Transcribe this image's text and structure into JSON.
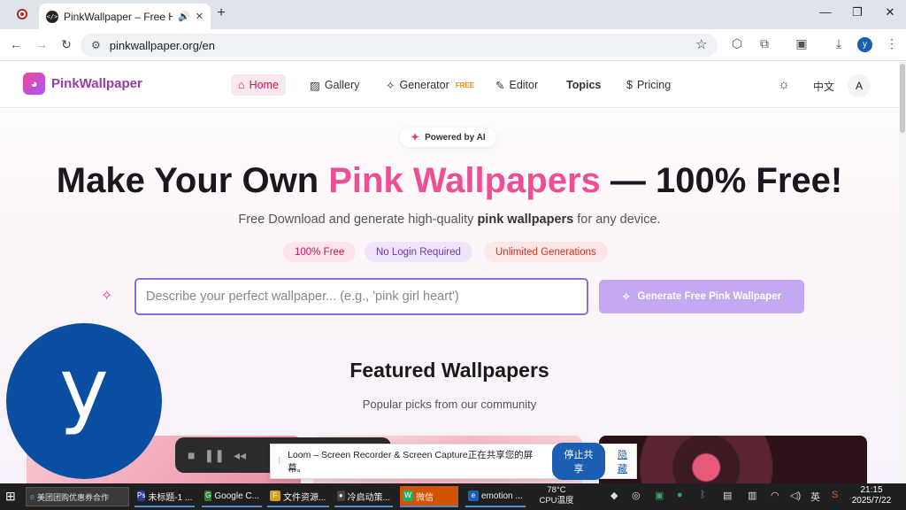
{
  "browser": {
    "tab_title": "PinkWallpaper – Free HD",
    "url": "pinkwallpaper.org/en",
    "profile_initial": "y"
  },
  "site": {
    "brand": "PinkWallpaper",
    "nav": {
      "home": "Home",
      "gallery": "Gallery",
      "generator": "Generator",
      "generator_badge": "FREE",
      "editor": "Editor",
      "topics": "Topics",
      "pricing": "Pricing"
    },
    "lang": "中文",
    "account_initial": "A"
  },
  "hero": {
    "badge": "Powered by AI",
    "headline_pre": "Make Your Own ",
    "headline_pink": "Pink Wallpapers",
    "headline_post": " — 100% Free!",
    "sub_pre": "Free Download and generate high-quality ",
    "sub_bold": "pink wallpapers",
    "sub_post": " for any device.",
    "chips": [
      "100% Free",
      "No Login Required",
      "Unlimited Generations"
    ],
    "prompt_placeholder": "Describe your perfect wallpaper... (e.g., 'pink girl heart')",
    "generate_label": "Generate Free Pink Wallpaper"
  },
  "featured": {
    "title": "Featured Wallpapers",
    "subtitle": "Popular picks from our community"
  },
  "overlay": {
    "avatar_letter": "y",
    "share_text": "Loom – Screen Recorder & Screen Capture正在共享您的屏幕。",
    "stop_share": "停止共享",
    "hide": "隐藏"
  },
  "taskbar": {
    "search_text": "美团团购优惠券合作",
    "apps": [
      {
        "label": "未标题-1 ...",
        "color": "#2b3f9e",
        "letter": "Ps"
      },
      {
        "label": "Google C...",
        "color": "#2e7d32",
        "letter": "G"
      },
      {
        "label": "文件资源...",
        "color": "#d6a21a",
        "letter": "F"
      },
      {
        "label": "冷启动策...",
        "color": "#444444",
        "letter": "●"
      },
      {
        "label": "微信",
        "color": "#2aae67",
        "letter": "W"
      },
      {
        "label": "emotion ...",
        "color": "#1a5fb4",
        "letter": "e"
      }
    ],
    "temp": "78°C",
    "temp_label": "CPU温度",
    "ime": "英",
    "time": "21:15",
    "date": "2025/7/22"
  }
}
